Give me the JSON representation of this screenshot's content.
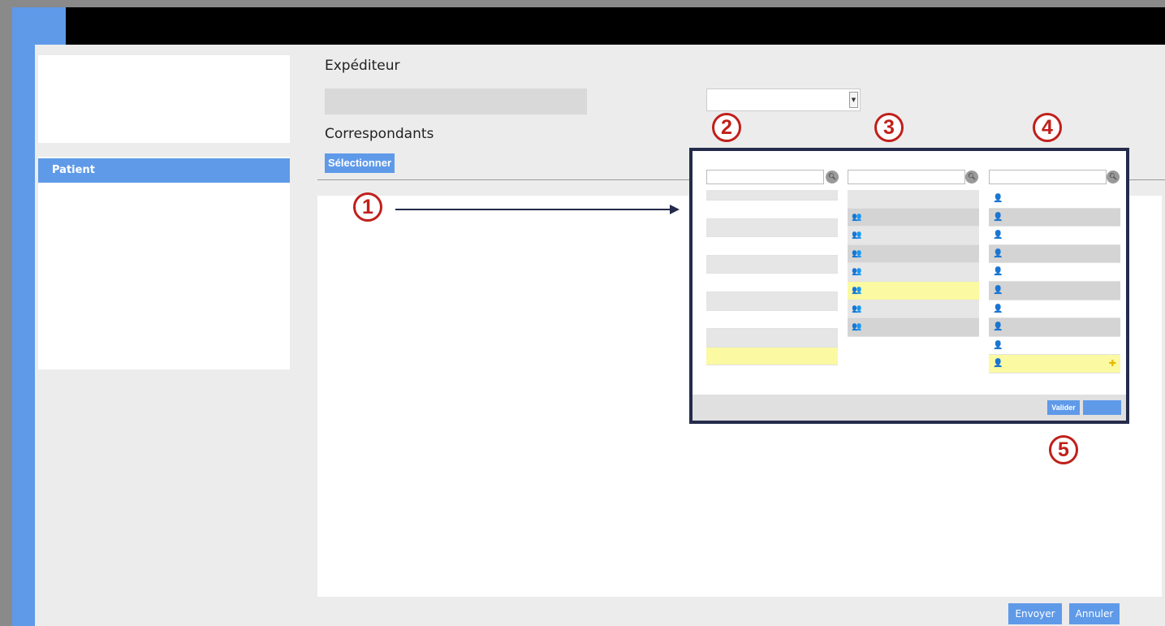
{
  "colors": {
    "accent": "#5f9ae9",
    "highlight": "#fbf9a2",
    "popup_border": "#242b4b",
    "callout": "#c0201b"
  },
  "sidebar": {
    "items": [
      {
        "label": "Patient"
      }
    ]
  },
  "form": {
    "sender_title": "Expéditeur",
    "sender_value": "",
    "recipient_select_value": "",
    "correspondants_title": "Correspondants",
    "select_button_label": "Sélectionner"
  },
  "popup": {
    "columns": [
      {
        "search_placeholder": "",
        "search_icon": "search-icon",
        "row_count": 10,
        "selected_row": 9
      },
      {
        "search_placeholder": "",
        "search_icon": "search-icon",
        "row_icon": "group-icon",
        "row_count": 8,
        "selected_row": 5
      },
      {
        "search_placeholder": "",
        "search_icon": "search-icon",
        "row_icon": "user-icon",
        "row_count": 10,
        "selected_row": 9,
        "selected_action_icon": "add-icon"
      }
    ],
    "validate_label": "Valider",
    "secondary_label": ""
  },
  "callouts": [
    "1",
    "2",
    "3",
    "4",
    "5"
  ],
  "footer": {
    "send_label": "Envoyer",
    "cancel_label": "Annuler"
  }
}
